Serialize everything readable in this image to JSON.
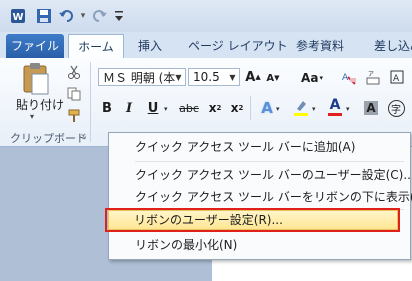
{
  "qat": {
    "save_icon": "save-icon",
    "undo_icon": "undo-icon",
    "redo_icon": "redo-icon",
    "customize_icon": "qat-customize-icon",
    "word_icon": "word-app-icon",
    "dropdown_glyph": "▾"
  },
  "tabs": {
    "file": "ファイル",
    "home": "ホーム",
    "insert": "挿入",
    "page_layout": "ページ レイアウト",
    "references": "参考資料",
    "mailings": "差し込み"
  },
  "clipboard": {
    "paste_label": "貼り付け",
    "group_label": "クリップボード",
    "launcher_glyph": "↘"
  },
  "font": {
    "name": "ＭＳ 明朝 (本",
    "size": "10.5",
    "grow_label": "A",
    "shrink_label": "A",
    "case_label": "Aa",
    "bold": "B",
    "italic": "I",
    "underline": "U",
    "strike": "abc",
    "subscript": "x",
    "superscript": "x",
    "sub_mark": "2",
    "sup_mark": "2",
    "text_effect": "A",
    "font_color": "A",
    "char_shade": "A",
    "enclosed_char": "字",
    "phonetic_label": "ア"
  },
  "menu": {
    "items": [
      "クイック アクセス ツール バーに追加(A)",
      "クイック アクセス ツール バーのユーザー設定(C)...",
      "クイック アクセス ツール バーをリボンの下に表示(S)",
      "リボンのユーザー設定(R)...",
      "リボンの最小化(N)"
    ],
    "highlighted_index": 3
  },
  "colors": {
    "file_tab": "#2a5fa8",
    "highlight_border": "#e0201b",
    "font_color_bar": "#e0201b",
    "highlighter_bar": "#ffff00"
  }
}
